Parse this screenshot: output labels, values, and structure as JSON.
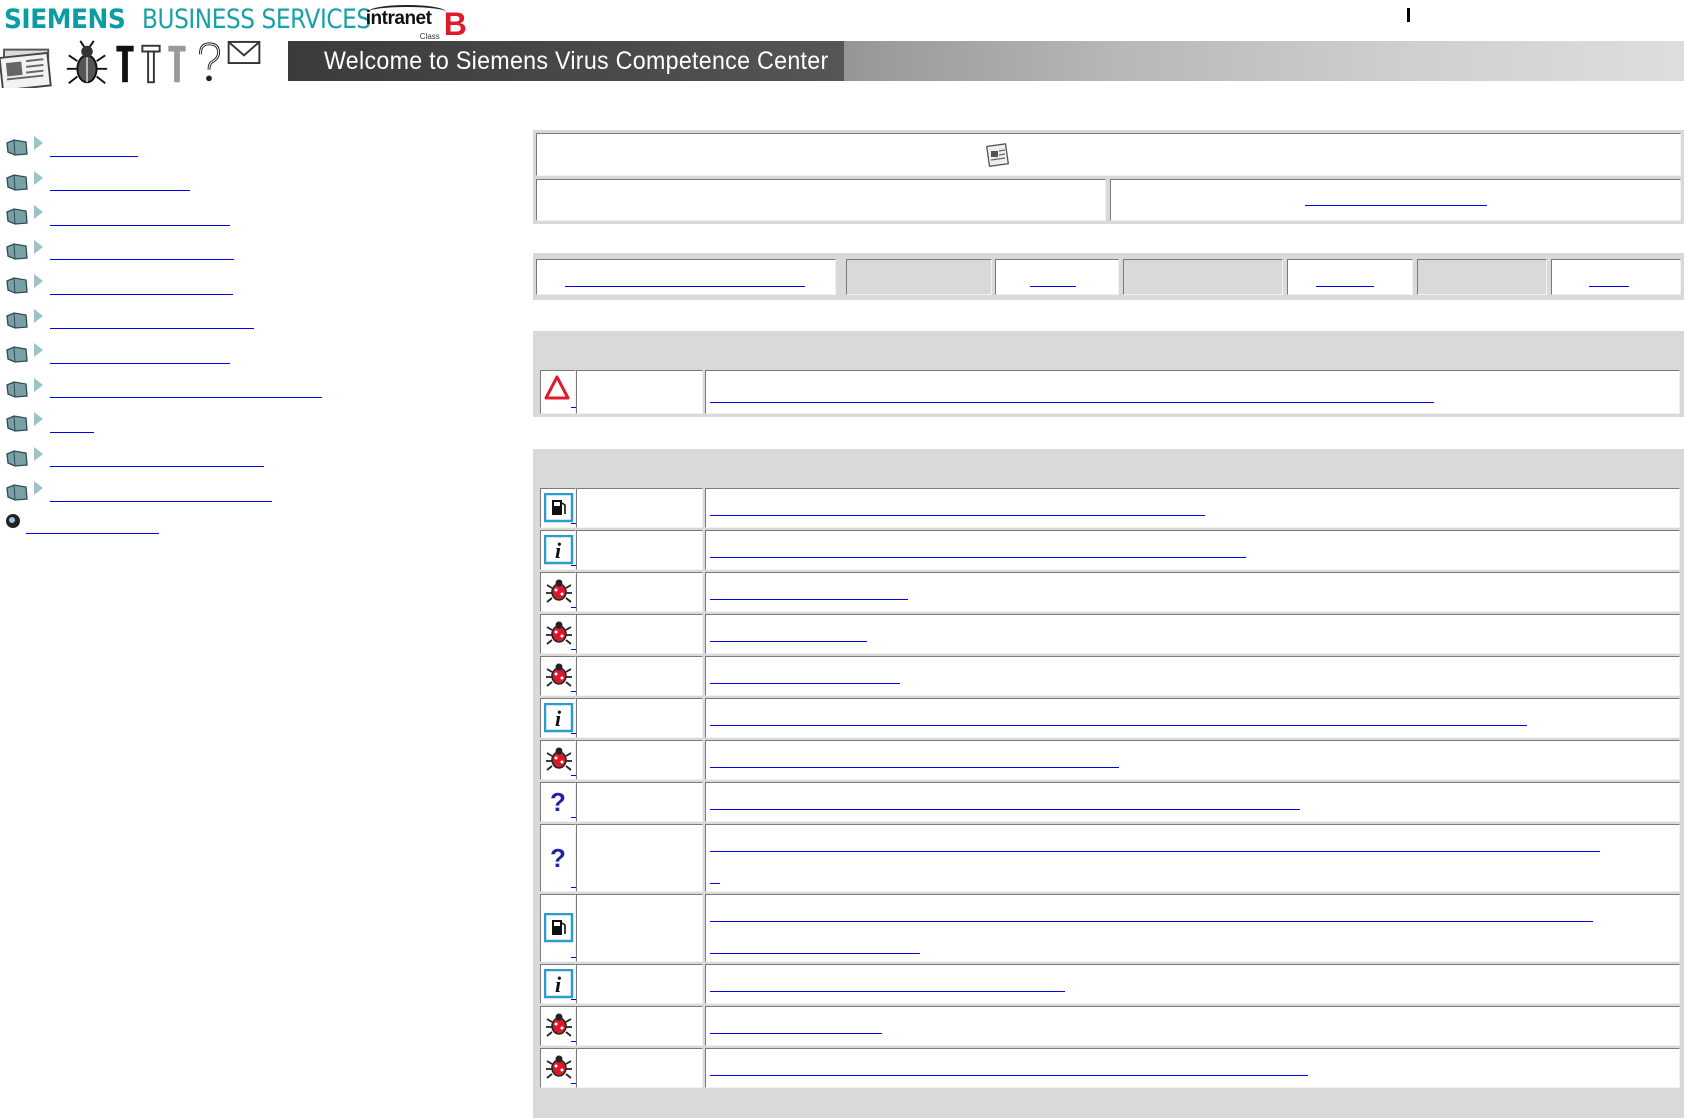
{
  "header": {
    "brand_siemens": "SIEMENS",
    "brand_business_services": "BUSINESS SERVICES",
    "intranet_word": "intranet",
    "intranet_class": "Class",
    "intranet_letter": "B",
    "banner_title": "Welcome to Siemens Virus Competence Center",
    "toolbar_icons": [
      "newspaper-icon",
      "bug-icon",
      "tool-icon",
      "tool-icon",
      "tool-icon",
      "help-icon",
      "mail-icon"
    ]
  },
  "colors": {
    "brand_teal": "#0b9da1",
    "intranet_red": "#e0192b",
    "link_blue": "#0000ee",
    "panel_grey": "#d9d9d9",
    "alert_red": "#e0192b",
    "info_blue": "#2d9ccb"
  },
  "sidebar": {
    "items": [
      {
        "icon": "folder-icon"
      },
      {
        "icon": "folder-icon"
      },
      {
        "icon": "folder-icon"
      },
      {
        "icon": "folder-icon"
      },
      {
        "icon": "folder-icon"
      },
      {
        "icon": "folder-icon"
      },
      {
        "icon": "folder-icon"
      },
      {
        "icon": "folder-icon"
      },
      {
        "icon": "folder-icon"
      },
      {
        "icon": "folder-icon"
      },
      {
        "icon": "folder-icon"
      }
    ],
    "gate_icon": "globe-icon"
  },
  "top_panel": {
    "icon": "newspaper-icon"
  },
  "alerts": {
    "rows": [
      {
        "icon": "warning-triangle-icon"
      }
    ]
  },
  "news": {
    "rows": [
      {
        "icon": "fuel-icon"
      },
      {
        "icon": "info-icon"
      },
      {
        "icon": "virus-bug-icon"
      },
      {
        "icon": "virus-bug-icon"
      },
      {
        "icon": "virus-bug-icon"
      },
      {
        "icon": "info-icon"
      },
      {
        "icon": "virus-bug-icon"
      },
      {
        "icon": "question-icon"
      },
      {
        "icon": "question-icon"
      },
      {
        "icon": "fuel-icon"
      },
      {
        "icon": "info-icon"
      },
      {
        "icon": "virus-bug-icon"
      },
      {
        "icon": "virus-bug-icon"
      }
    ]
  }
}
